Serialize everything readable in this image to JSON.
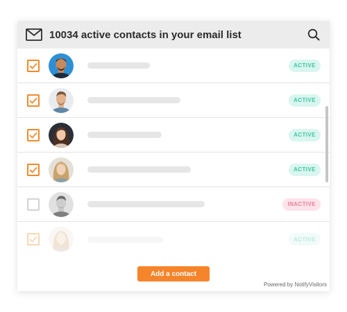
{
  "header": {
    "title": "10034 active contacts in your email list",
    "mail_icon": "mail-icon",
    "search_icon": "search-icon"
  },
  "contacts": [
    {
      "checked": true,
      "status": "ACTIVE"
    },
    {
      "checked": true,
      "status": "ACTIVE"
    },
    {
      "checked": true,
      "status": "ACTIVE"
    },
    {
      "checked": true,
      "status": "ACTIVE"
    },
    {
      "checked": false,
      "status": "INACTIVE"
    },
    {
      "checked": true,
      "status": "ACTIVE"
    }
  ],
  "footer": {
    "add_button_label": "Add a contact",
    "powered_by": "Powered by NotifyVisitors"
  },
  "colors": {
    "accent": "#f5842b",
    "active_badge_bg": "#d8f6ef",
    "active_badge_text": "#3fc4a1",
    "inactive_badge_bg": "#fde3ea",
    "inactive_badge_text": "#ec7f9e"
  }
}
